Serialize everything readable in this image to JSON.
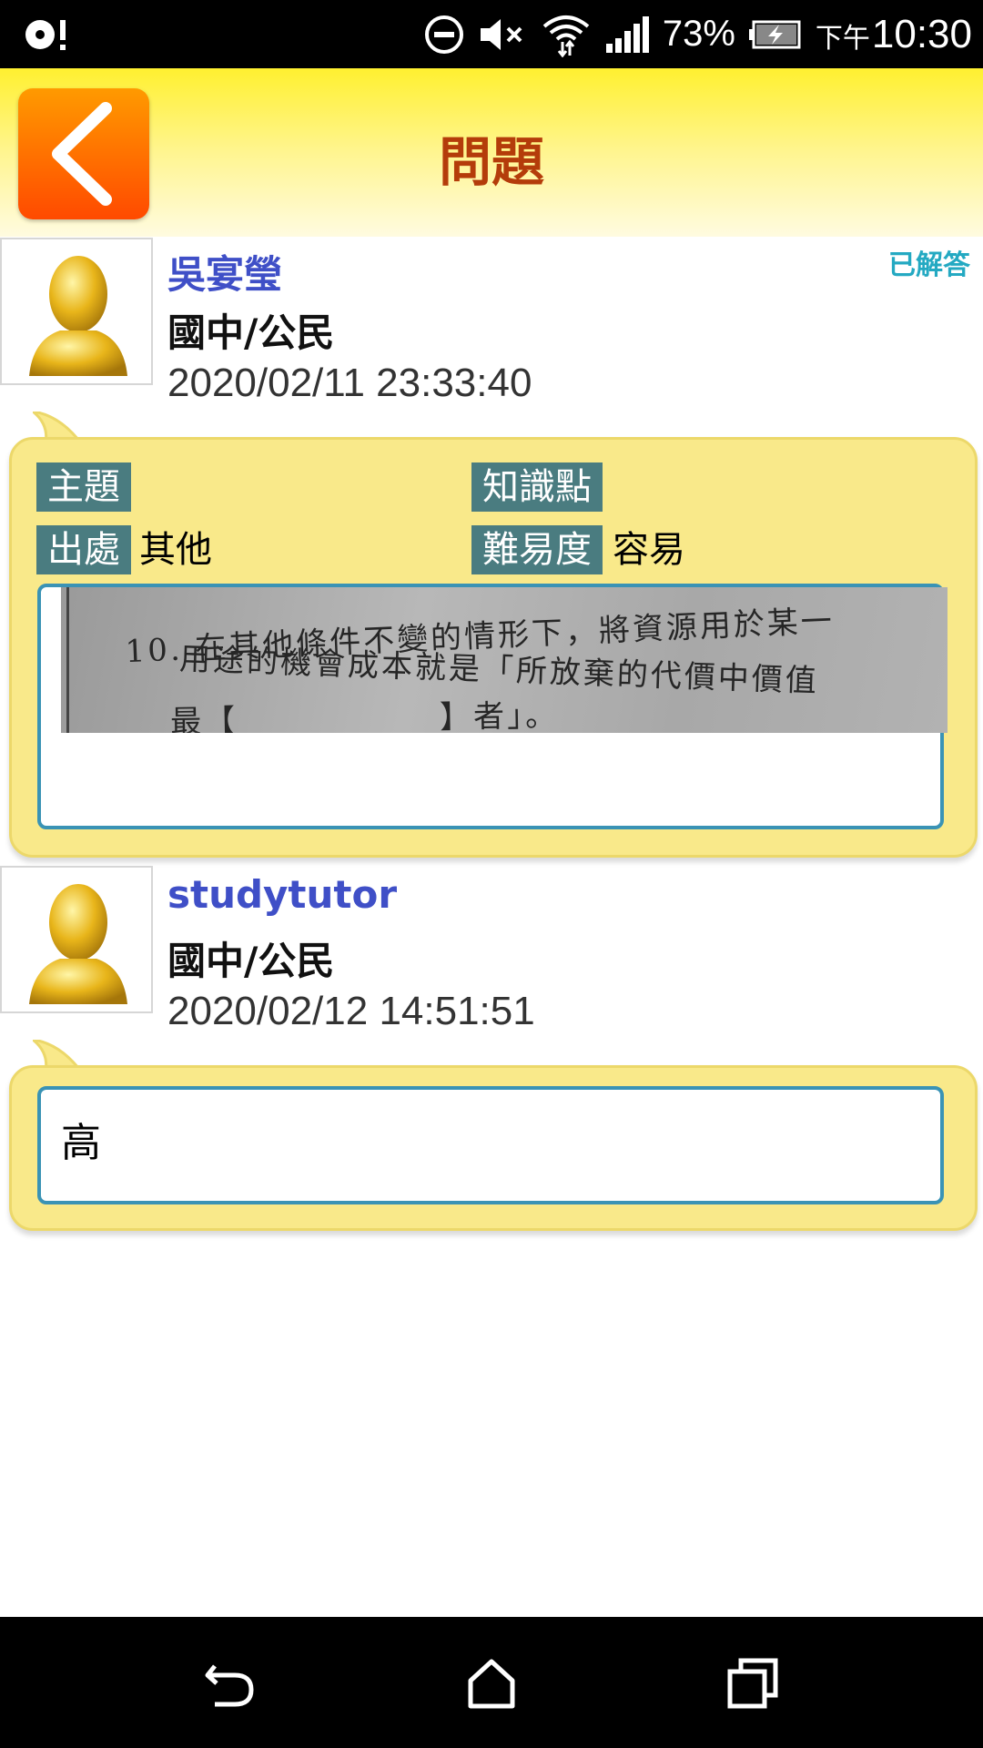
{
  "status_bar": {
    "battery_percent": "73%",
    "time_prefix": "下午",
    "time": "10:30",
    "icons": [
      "notification-icon",
      "dnd-icon",
      "mute-icon",
      "wifi-icon",
      "signal-icon",
      "battery-charging-icon"
    ]
  },
  "header": {
    "title": "問題",
    "back_icon": "chevron-left-icon"
  },
  "question": {
    "author": "吳宴瑩",
    "subject": "國中/公民",
    "time": "2020/02/11 23:33:40",
    "status": "已解答",
    "fields": {
      "topic_label": "主題",
      "topic_value": "",
      "knowledge_label": "知識點",
      "knowledge_value": "",
      "source_label": "出處",
      "source_value": "其他",
      "difficulty_label": "難易度",
      "difficulty_value": "容易"
    },
    "photo_lines": [
      "10. 在其他條件不變的情形下，將資源用於某一",
      "用途的機會成本就是「所放棄的代價中價值",
      "最【　　　　　　】者」。"
    ]
  },
  "answer": {
    "author": "studytutor",
    "subject": "國中/公民",
    "time": "2020/02/12 14:51:51",
    "text": "高"
  },
  "nav_bar": {
    "icons": [
      "back-nav-icon",
      "home-icon",
      "recents-icon"
    ]
  },
  "colors": {
    "accent_orange": "#ff6a00",
    "title_color": "#b43c0a",
    "author_color": "#3f4fc7",
    "bubble_bg": "#f9e98a",
    "tag_bg": "#4a7c80",
    "box_border": "#3a93b5",
    "answered_color": "#24a9c2"
  }
}
